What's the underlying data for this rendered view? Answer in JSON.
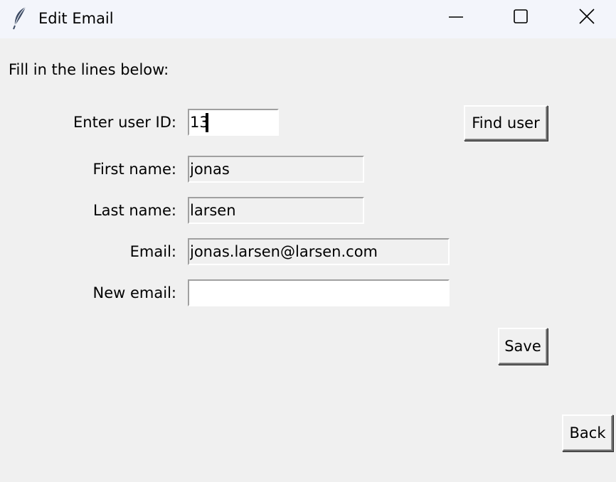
{
  "window": {
    "title": "Edit Email",
    "icons": {
      "app": "feather-icon",
      "minimize": "minimize-icon",
      "maximize": "maximize-icon",
      "close": "close-icon"
    }
  },
  "form": {
    "instruction": "Fill in the lines below:",
    "user_id_label": "Enter user ID:",
    "user_id_value": "13",
    "find_user_label": "Find user",
    "first_name_label": "First name:",
    "first_name_value": "jonas",
    "last_name_label": "Last name:",
    "last_name_value": "larsen",
    "email_label": "Email:",
    "email_value": "jonas.larsen@larsen.com",
    "new_email_label": "New email:",
    "new_email_value": "",
    "save_label": "Save",
    "back_label": "Back"
  },
  "colors": {
    "titlebar_bg": "#f3f5fb",
    "window_bg": "#f0f0f0",
    "entry_bg": "#ffffff"
  }
}
